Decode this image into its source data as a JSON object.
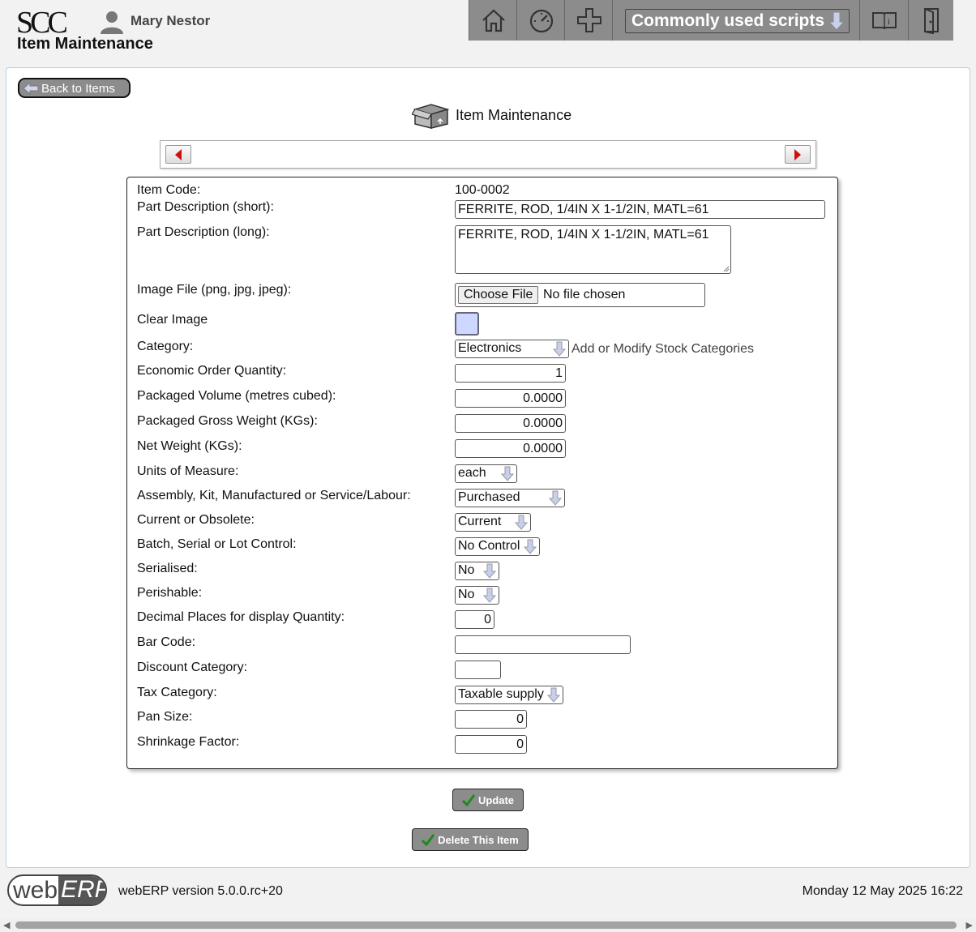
{
  "header": {
    "logo_text": "SCC",
    "user_name": "Mary Nestor",
    "app_title": "Item Maintenance",
    "scripts_menu": "Commonly used scripts"
  },
  "back_button": "Back to Items",
  "page_heading": "Item Maintenance",
  "form": {
    "item_code_label": "Item Code:",
    "item_code_value": "100-0002",
    "short_desc_label": "Part Description (short):",
    "short_desc_value": "FERRITE, ROD, 1/4IN X 1-1/2IN, MATL=61",
    "long_desc_label": "Part Description (long):",
    "long_desc_value": "FERRITE, ROD, 1/4IN X 1-1/2IN, MATL=61",
    "image_file_label": "Image File (png, jpg, jpeg):",
    "choose_file": "Choose File",
    "no_file": "No file chosen",
    "clear_image_label": "Clear Image",
    "category_label": "Category:",
    "category_value": "Electronics",
    "category_link": "Add or Modify Stock Categories",
    "eoq_label": "Economic Order Quantity:",
    "eoq_value": "1",
    "volume_label": "Packaged Volume (metres cubed):",
    "volume_value": "0.0000",
    "gross_weight_label": "Packaged Gross Weight (KGs):",
    "gross_weight_value": "0.0000",
    "net_weight_label": "Net Weight (KGs):",
    "net_weight_value": "0.0000",
    "uom_label": "Units of Measure:",
    "uom_value": "each",
    "mbflag_label": "Assembly, Kit, Manufactured or Service/Labour:",
    "mbflag_value": "Purchased",
    "obsolete_label": "Current or Obsolete:",
    "obsolete_value": "Current",
    "control_label": "Batch, Serial or Lot Control:",
    "control_value": "No Control",
    "serialised_label": "Serialised:",
    "serialised_value": "No",
    "perishable_label": "Perishable:",
    "perishable_value": "No",
    "decimals_label": "Decimal Places for display Quantity:",
    "decimals_value": "0",
    "barcode_label": "Bar Code:",
    "barcode_value": "",
    "discount_label": "Discount Category:",
    "discount_value": "",
    "tax_label": "Tax Category:",
    "tax_value": "Taxable supply",
    "pansize_label": "Pan Size:",
    "pansize_value": "0",
    "shrinkage_label": "Shrinkage Factor:",
    "shrinkage_value": "0"
  },
  "buttons": {
    "update": "Update",
    "delete": "Delete This Item"
  },
  "footer": {
    "logo_web": "web",
    "logo_erp": "ERP",
    "version": "webERP version 5.0.0.rc+20",
    "datetime": "Monday 12 May 2025 16:22"
  },
  "colors": {
    "nav_bg": "#8c8c8c",
    "checkbox_fill": "#ccd8ff",
    "pager_arrow": "#cc1111"
  }
}
